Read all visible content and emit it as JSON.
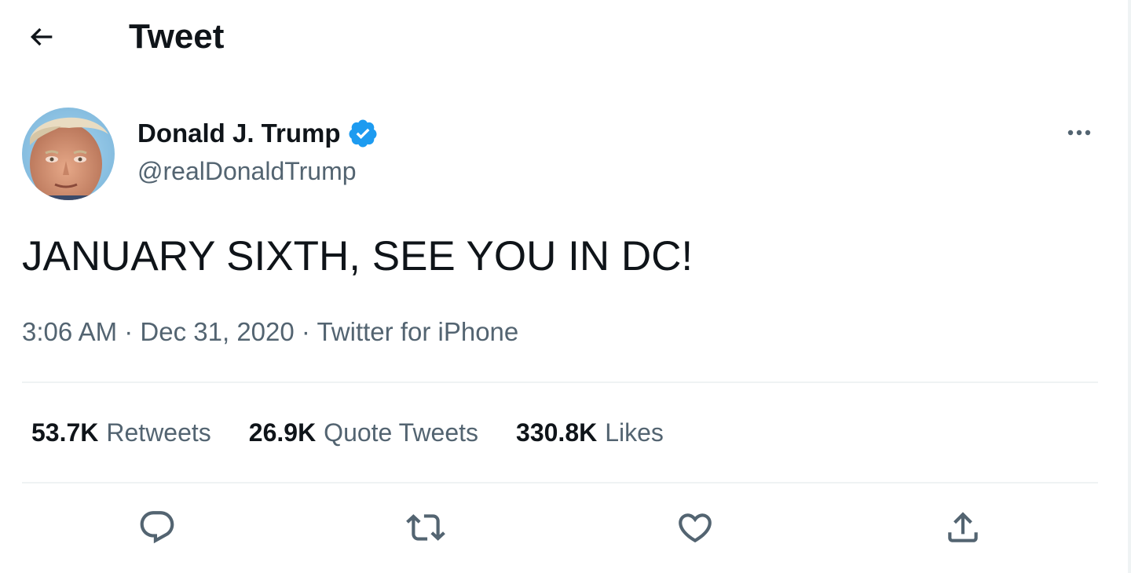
{
  "header": {
    "title": "Tweet",
    "back_icon": "arrow-left-icon"
  },
  "author": {
    "name": "Donald J. Trump",
    "handle": "@realDonaldTrump",
    "verified": true,
    "verified_color": "#1d9bf0"
  },
  "tweet": {
    "text": "JANUARY SIXTH, SEE YOU IN DC!",
    "time": "3:06 AM",
    "separator": "·",
    "date": "Dec 31, 2020",
    "source": "Twitter for iPhone"
  },
  "stats": [
    {
      "count": "53.7K",
      "label": "Retweets"
    },
    {
      "count": "26.9K",
      "label": "Quote Tweets"
    },
    {
      "count": "330.8K",
      "label": "Likes"
    }
  ],
  "actions": [
    {
      "icon": "reply-icon"
    },
    {
      "icon": "retweet-icon"
    },
    {
      "icon": "like-heart-icon"
    },
    {
      "icon": "share-icon"
    }
  ],
  "colors": {
    "text_primary": "#0f1419",
    "text_secondary": "#536471",
    "divider": "#eff3f4",
    "accent": "#1d9bf0"
  }
}
